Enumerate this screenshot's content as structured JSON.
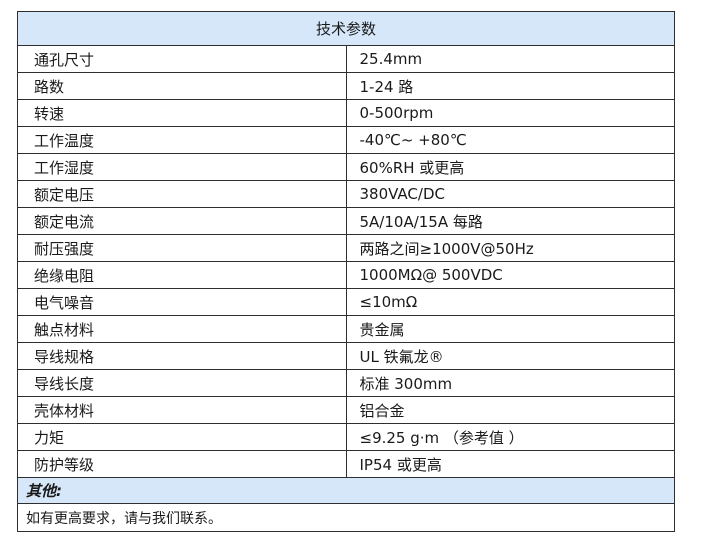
{
  "title": "技术参数",
  "rows": [
    {
      "param": "通孔尺寸",
      "value": "25.4mm"
    },
    {
      "param": "路数",
      "value": "1-24 路"
    },
    {
      "param": "转速",
      "value": "0-500rpm"
    },
    {
      "param": "工作温度",
      "value": "-40℃~ +80℃"
    },
    {
      "param": "工作湿度",
      "value": "60%RH 或更高"
    },
    {
      "param": "额定电压",
      "value": "380VAC/DC"
    },
    {
      "param": "额定电流",
      "value": "5A/10A/15A 每路"
    },
    {
      "param": "耐压强度",
      "value": "两路之间≥1000V@50Hz"
    },
    {
      "param": "绝缘电阻",
      "value": "1000MΩ@ 500VDC"
    },
    {
      "param": "电气噪音",
      "value": "≤10mΩ"
    },
    {
      "param": "触点材料",
      "value": "贵金属"
    },
    {
      "param": "导线规格",
      "value": "UL 铁氟龙®"
    },
    {
      "param": "导线长度",
      "value": "标准 300mm"
    },
    {
      "param": "壳体材料",
      "value": "铝合金"
    },
    {
      "param": "力矩",
      "value": "≤9.25 g·m （参考值 ）"
    },
    {
      "param": "防护等级",
      "value": "IP54 或更高"
    }
  ],
  "other_label": "其他:",
  "note": "如有更高要求，请与我们联系。",
  "colors": {
    "header_bg": "#d6e7f9",
    "border": "#2f2f2f"
  }
}
